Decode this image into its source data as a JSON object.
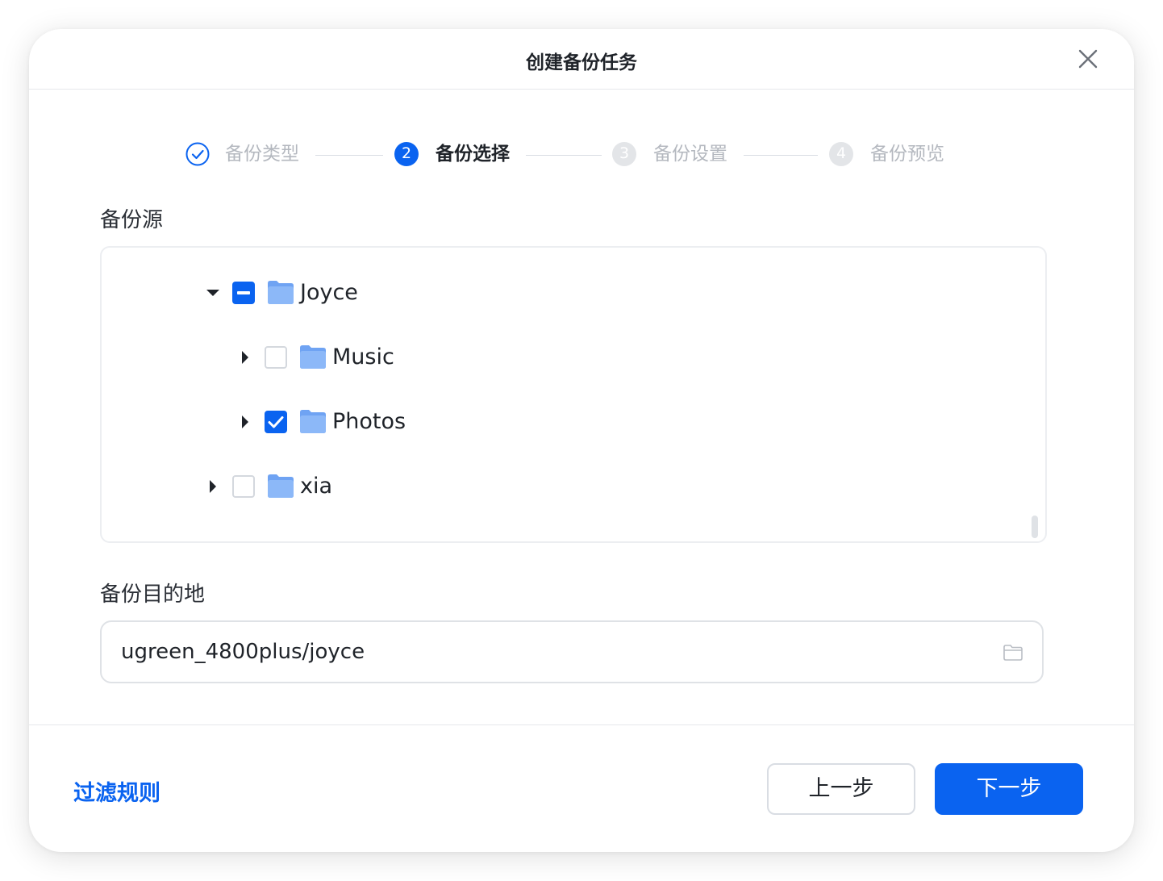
{
  "dialog": {
    "title": "创建备份任务",
    "close_icon": "close-icon"
  },
  "stepper": {
    "steps": [
      {
        "number": "1",
        "label": "备份类型",
        "state": "done",
        "icon": "check-circle-icon"
      },
      {
        "number": "2",
        "label": "备份选择",
        "state": "active"
      },
      {
        "number": "3",
        "label": "备份设置",
        "state": "pending"
      },
      {
        "number": "4",
        "label": "备份预览",
        "state": "pending"
      }
    ]
  },
  "source": {
    "label": "备份源",
    "tree": [
      {
        "name": "Joyce",
        "expanded": true,
        "check_state": "indeterminate",
        "depth": 0,
        "icon": "folder-icon"
      },
      {
        "name": "Music",
        "expanded": false,
        "check_state": "unchecked",
        "depth": 1,
        "icon": "folder-icon"
      },
      {
        "name": "Photos",
        "expanded": false,
        "check_state": "checked",
        "depth": 1,
        "icon": "folder-icon"
      },
      {
        "name": "xia",
        "expanded": false,
        "check_state": "unchecked",
        "depth": 0,
        "icon": "folder-icon"
      }
    ]
  },
  "destination": {
    "label": "备份目的地",
    "value": "ugreen_4800plus/joyce",
    "browse_icon": "folder-outline-icon"
  },
  "footer": {
    "filter_link": "过滤规则",
    "prev_button": "上一步",
    "next_button": "下一步"
  },
  "colors": {
    "accent": "#0a63f0",
    "text_primary": "#1f2329",
    "text_disabled": "#b4b8bf",
    "folder": "#7fb0f7"
  }
}
